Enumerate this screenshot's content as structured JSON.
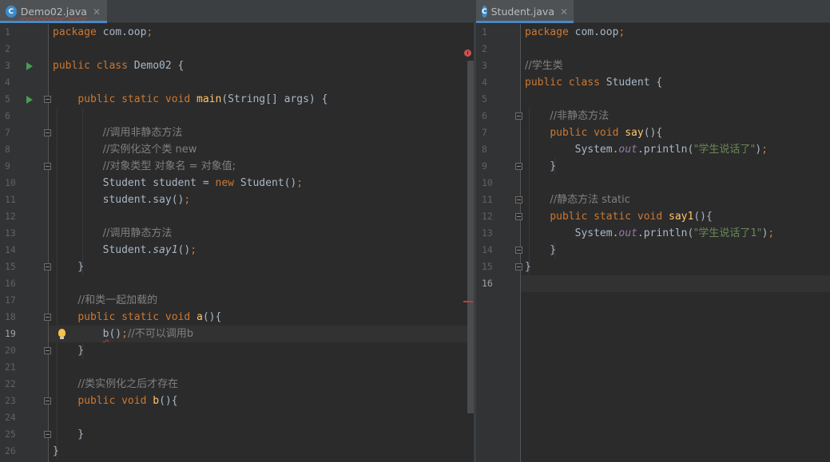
{
  "left_editor": {
    "tab": {
      "icon": "class-icon",
      "icon_letter": "C",
      "filename": "Demo02.java",
      "close": "✕"
    },
    "current_line": 19,
    "lines": [
      {
        "n": "1",
        "tokens": [
          [
            "kw",
            "package "
          ],
          [
            "",
            "com.oop"
          ],
          [
            "kw",
            ";"
          ]
        ]
      },
      {
        "n": "2",
        "tokens": []
      },
      {
        "n": "3",
        "run": true,
        "tokens": [
          [
            "kw",
            "public class "
          ],
          [
            "",
            "Demo02 {"
          ]
        ]
      },
      {
        "n": "4",
        "tokens": []
      },
      {
        "n": "5",
        "run": true,
        "fold": true,
        "tokens": [
          [
            "",
            "    "
          ],
          [
            "kw",
            "public static void "
          ],
          [
            "fn",
            "main"
          ],
          [
            "",
            "(String[] args) {"
          ]
        ]
      },
      {
        "n": "6",
        "tokens": []
      },
      {
        "n": "7",
        "fold": true,
        "tokens": [
          [
            "",
            "        "
          ],
          [
            "cm",
            "//调用非静态方法"
          ]
        ]
      },
      {
        "n": "8",
        "tokens": [
          [
            "",
            "        "
          ],
          [
            "cm",
            "//实例化这个类 new"
          ]
        ]
      },
      {
        "n": "9",
        "fold": true,
        "tokens": [
          [
            "",
            "        "
          ],
          [
            "cm",
            "//对象类型 对象名 = 对象值;"
          ]
        ]
      },
      {
        "n": "10",
        "tokens": [
          [
            "",
            "        Student student = "
          ],
          [
            "kw",
            "new "
          ],
          [
            "",
            "Student()"
          ],
          [
            "kw",
            ";"
          ]
        ]
      },
      {
        "n": "11",
        "tokens": [
          [
            "",
            "        student.say()"
          ],
          [
            "kw",
            ";"
          ]
        ]
      },
      {
        "n": "12",
        "tokens": []
      },
      {
        "n": "13",
        "tokens": [
          [
            "",
            "        "
          ],
          [
            "cm",
            "//调用静态方法"
          ]
        ]
      },
      {
        "n": "14",
        "tokens": [
          [
            "",
            "        Student."
          ],
          [
            "it",
            "say1"
          ],
          [
            "",
            "()"
          ],
          [
            "kw",
            ";"
          ]
        ]
      },
      {
        "n": "15",
        "fold": true,
        "tokens": [
          [
            "",
            "    }"
          ]
        ]
      },
      {
        "n": "16",
        "tokens": []
      },
      {
        "n": "17",
        "tokens": [
          [
            "",
            "    "
          ],
          [
            "cm",
            "//和类一起加载的"
          ]
        ]
      },
      {
        "n": "18",
        "fold": true,
        "tokens": [
          [
            "",
            "    "
          ],
          [
            "kw",
            "public static void "
          ],
          [
            "fn",
            "a"
          ],
          [
            "",
            "(){"
          ]
        ]
      },
      {
        "n": "19",
        "bulb": true,
        "tokens": [
          [
            "",
            "        "
          ],
          [
            "err",
            "b"
          ],
          [
            "",
            "()"
          ],
          [
            "kw",
            ";"
          ],
          [
            "cm",
            "//不可以调用b"
          ]
        ]
      },
      {
        "n": "20",
        "fold": true,
        "tokens": [
          [
            "",
            "    }"
          ]
        ]
      },
      {
        "n": "21",
        "tokens": []
      },
      {
        "n": "22",
        "tokens": [
          [
            "",
            "    "
          ],
          [
            "cm",
            "//类实例化之后才存在"
          ]
        ]
      },
      {
        "n": "23",
        "fold": true,
        "tokens": [
          [
            "",
            "    "
          ],
          [
            "kw",
            "public void "
          ],
          [
            "fn",
            "b"
          ],
          [
            "",
            "(){"
          ]
        ]
      },
      {
        "n": "24",
        "tokens": []
      },
      {
        "n": "25",
        "fold": true,
        "tokens": [
          [
            "",
            "    }"
          ]
        ]
      },
      {
        "n": "26",
        "tokens": [
          [
            "",
            "}"
          ]
        ]
      }
    ]
  },
  "right_editor": {
    "tab": {
      "icon": "class-icon",
      "icon_letter": "C",
      "filename": "Student.java",
      "close": "✕"
    },
    "current_line": 16,
    "lines": [
      {
        "n": "1",
        "tokens": [
          [
            "kw",
            "package "
          ],
          [
            "",
            "com.oop"
          ],
          [
            "kw",
            ";"
          ]
        ]
      },
      {
        "n": "2",
        "tokens": []
      },
      {
        "n": "3",
        "tokens": [
          [
            "cm",
            "//学生类"
          ]
        ]
      },
      {
        "n": "4",
        "tokens": [
          [
            "kw",
            "public class "
          ],
          [
            "",
            "Student {"
          ]
        ]
      },
      {
        "n": "5",
        "tokens": []
      },
      {
        "n": "6",
        "fold": true,
        "tokens": [
          [
            "",
            "    "
          ],
          [
            "cm",
            "//非静态方法"
          ]
        ]
      },
      {
        "n": "7",
        "tokens": [
          [
            "",
            "    "
          ],
          [
            "kw",
            "public void "
          ],
          [
            "fn",
            "say"
          ],
          [
            "",
            "(){"
          ]
        ]
      },
      {
        "n": "8",
        "tokens": [
          [
            "",
            "        System."
          ],
          [
            "fld",
            "out"
          ],
          [
            "",
            ".println("
          ],
          [
            "st",
            "\"学生说话了\""
          ],
          [
            "",
            ")"
          ],
          [
            "kw",
            ";"
          ]
        ]
      },
      {
        "n": "9",
        "fold": true,
        "tokens": [
          [
            "",
            "    }"
          ]
        ]
      },
      {
        "n": "10",
        "tokens": []
      },
      {
        "n": "11",
        "fold": true,
        "tokens": [
          [
            "",
            "    "
          ],
          [
            "cm",
            "//静态方法 static"
          ]
        ]
      },
      {
        "n": "12",
        "fold": true,
        "tokens": [
          [
            "",
            "    "
          ],
          [
            "kw",
            "public static void "
          ],
          [
            "fn",
            "say1"
          ],
          [
            "",
            "(){"
          ]
        ]
      },
      {
        "n": "13",
        "tokens": [
          [
            "",
            "        System."
          ],
          [
            "fld",
            "out"
          ],
          [
            "",
            ".println("
          ],
          [
            "st",
            "\"学生说话了1\""
          ],
          [
            "",
            ")"
          ],
          [
            "kw",
            ";"
          ]
        ]
      },
      {
        "n": "14",
        "fold": true,
        "tokens": [
          [
            "",
            "    }"
          ]
        ]
      },
      {
        "n": "15",
        "fold": true,
        "tokens": [
          [
            "",
            "}"
          ]
        ]
      },
      {
        "n": "16",
        "tokens": []
      }
    ]
  },
  "colors": {
    "keyword": "#cc7832",
    "method": "#ffc66d",
    "comment": "#808080",
    "string": "#6a8759",
    "field": "#9876aa",
    "text": "#a9b7c6",
    "error_underline": "#bc3f3c",
    "run_icon": "#499c54",
    "tab_accent": "#4a88c7"
  }
}
